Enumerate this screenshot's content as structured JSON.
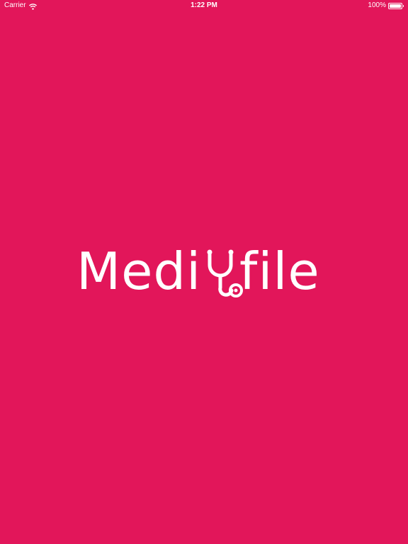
{
  "status_bar": {
    "carrier": "Carrier",
    "time": "1:22 PM",
    "battery": "100%",
    "wifi_icon": "wifi-icon",
    "battery_icon": "battery-icon"
  },
  "logo": {
    "text_left": "Medi",
    "text_right": "file",
    "icon": "stethoscope-icon"
  },
  "colors": {
    "background": "#e2165a",
    "foreground": "#ffffff"
  }
}
